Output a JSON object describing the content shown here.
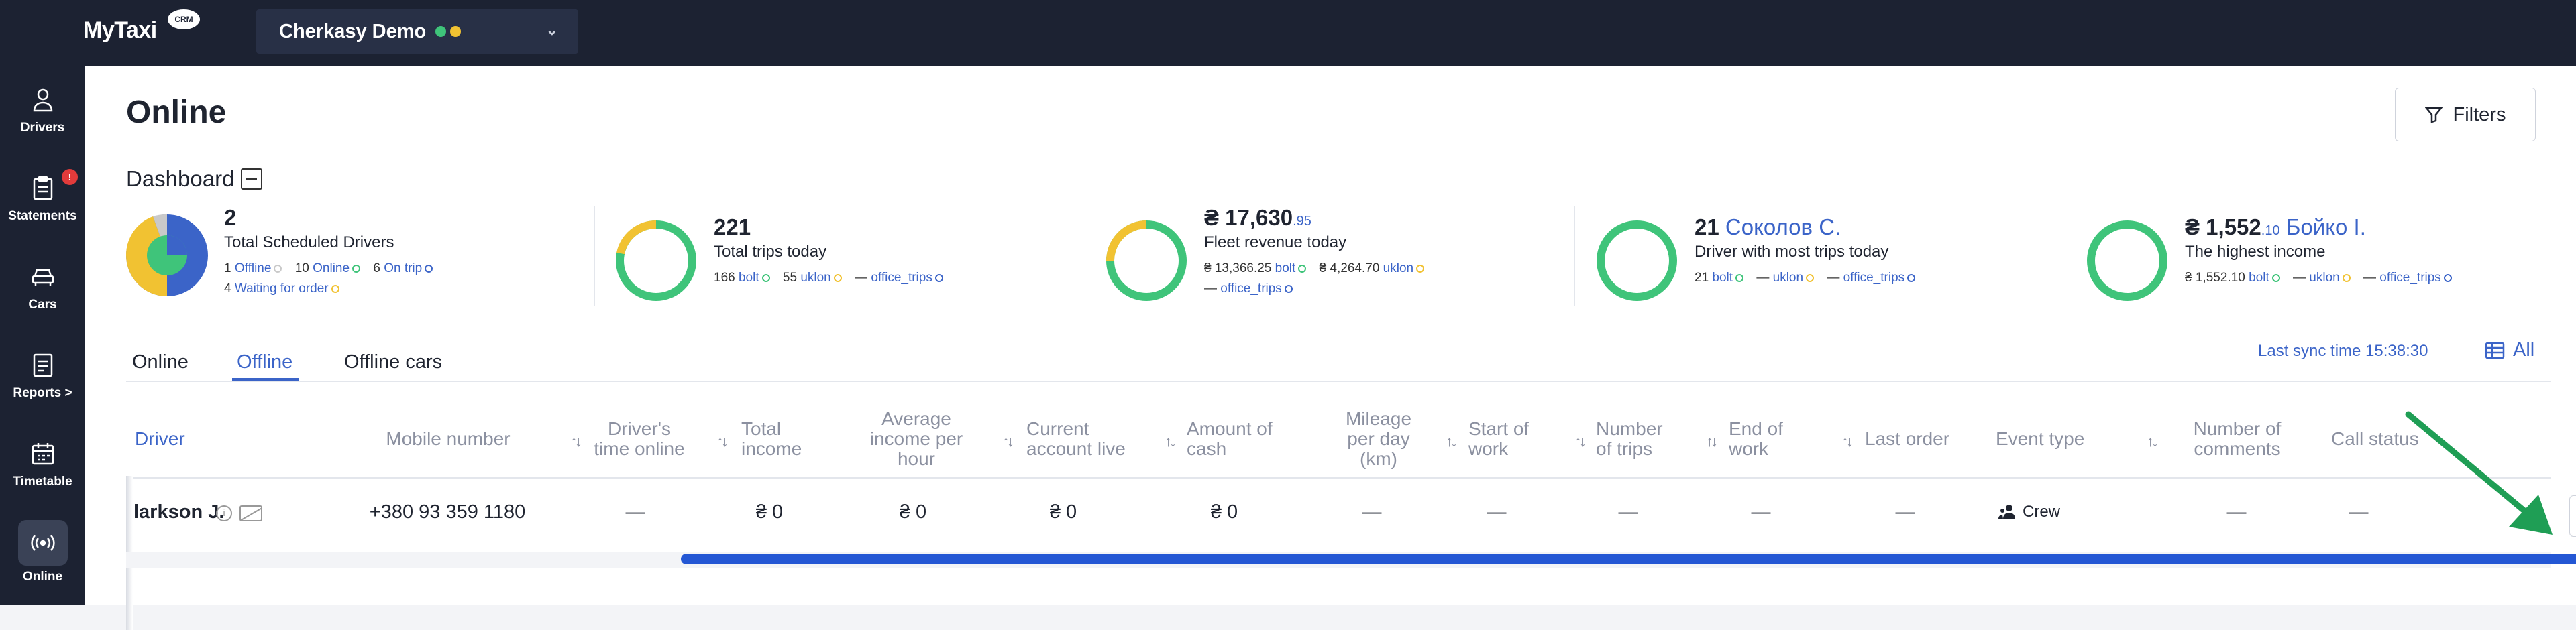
{
  "app": {
    "logo": "MyTaxi",
    "logo_badge": "CRM",
    "company": "Cherkasy Demo"
  },
  "sidebar": {
    "items": [
      {
        "label": "Drivers",
        "icon": "user-icon"
      },
      {
        "label": "Statements",
        "icon": "clipboard-icon",
        "badge": "!"
      },
      {
        "label": "Cars",
        "icon": "car-icon"
      },
      {
        "label": "Reports >",
        "icon": "report-icon"
      },
      {
        "label": "Timetable",
        "icon": "calendar-icon"
      },
      {
        "label": "Online",
        "icon": "broadcast-icon",
        "active": true
      }
    ]
  },
  "page": {
    "title": "Online",
    "filters_label": "Filters",
    "dashboard_label": "Dashboard"
  },
  "cards": [
    {
      "big": "2",
      "sub": "Total Scheduled Drivers",
      "legend": [
        {
          "n": "1",
          "label": "Offline",
          "color": "#c9c9c9"
        },
        {
          "n": "10",
          "label": "Online",
          "color": "#3fc47a"
        },
        {
          "n": "6",
          "label": "On trip",
          "color": "#3b64c8"
        },
        {
          "n": "4",
          "label": "Waiting for order",
          "color": "#f1c232"
        }
      ]
    },
    {
      "big": "221",
      "sub": "Total trips today",
      "legend": [
        {
          "n": "166",
          "label": "bolt",
          "color": "#3fc47a"
        },
        {
          "n": "55",
          "label": "uklon",
          "color": "#f1c232"
        },
        {
          "n": "—",
          "label": "office_trips",
          "color": "#3b64c8"
        }
      ]
    },
    {
      "big": "₴ 17,630",
      "cents": ".95",
      "sub": "Fleet revenue today",
      "legend": [
        {
          "n": "₴ 13,366.25",
          "label": "bolt",
          "color": "#3fc47a"
        },
        {
          "n": "₴ 4,264.70",
          "label": "uklon",
          "color": "#f1c232"
        },
        {
          "n": "—",
          "label": "office_trips",
          "color": "#3b64c8"
        }
      ]
    },
    {
      "big": "21",
      "person": "Соколов С.",
      "sub": "Driver with most trips today",
      "legend": [
        {
          "n": "21",
          "label": "bolt",
          "color": "#3fc47a"
        },
        {
          "n": "—",
          "label": "uklon",
          "color": "#f1c232"
        },
        {
          "n": "—",
          "label": "office_trips",
          "color": "#3b64c8"
        }
      ]
    },
    {
      "big": "₴ 1,552",
      "cents": ".10",
      "person": "Бойко І.",
      "sub": "The highest income",
      "legend": [
        {
          "n": "₴ 1,552.10",
          "label": "bolt",
          "color": "#3fc47a"
        },
        {
          "n": "—",
          "label": "uklon",
          "color": "#f1c232"
        },
        {
          "n": "—",
          "label": "office_trips",
          "color": "#3b64c8"
        }
      ]
    }
  ],
  "tabs": [
    "Online",
    "Offline",
    "Offline cars"
  ],
  "active_tab": "Offline",
  "sync_text": "Last sync time 15:38:30",
  "view_all": "All",
  "table": {
    "headers": [
      "Driver",
      "Mobile number",
      "Driver's time online",
      "Total income",
      "Average income per hour",
      "Current account live",
      "Amount of cash",
      "Mileage per day (km)",
      "Start of work",
      "Number of trips",
      "End of work",
      "Last order",
      "Event type",
      "Number of comments",
      "Call status"
    ],
    "row": {
      "driver": "larkson J.",
      "mobile": "+380 93 359 1180",
      "time_online": "—",
      "total_income": "₴ 0",
      "avg_income": "₴ 0",
      "account_live": "₴ 0",
      "cash": "₴ 0",
      "mileage": "—",
      "start": "—",
      "trips": "—",
      "end": "—",
      "last_order": "—",
      "event_type": "Crew",
      "comments": "—",
      "call_status": "—"
    }
  },
  "colors": {
    "accent": "#3b64c8",
    "nav_bg": "#1c2232",
    "bolt": "#3fc47a",
    "uklon": "#f1c232",
    "annotation_arrow": "#1f9e55"
  }
}
